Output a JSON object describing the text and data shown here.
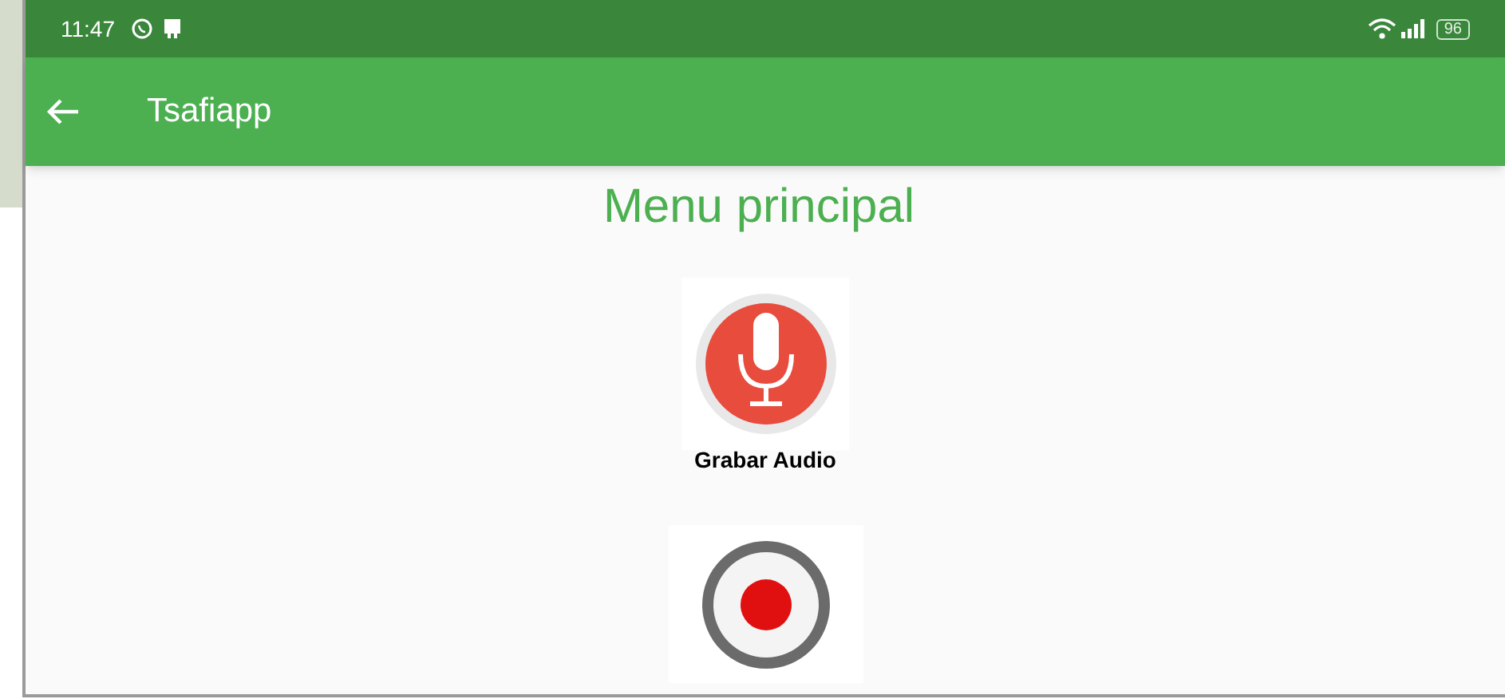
{
  "status_bar": {
    "time": "11:47",
    "battery": "96"
  },
  "app_bar": {
    "title": "Tsafiapp"
  },
  "heading": "Menu principal",
  "menu": [
    {
      "kind": "audio",
      "label": "Grabar Audio"
    },
    {
      "kind": "video"
    }
  ]
}
